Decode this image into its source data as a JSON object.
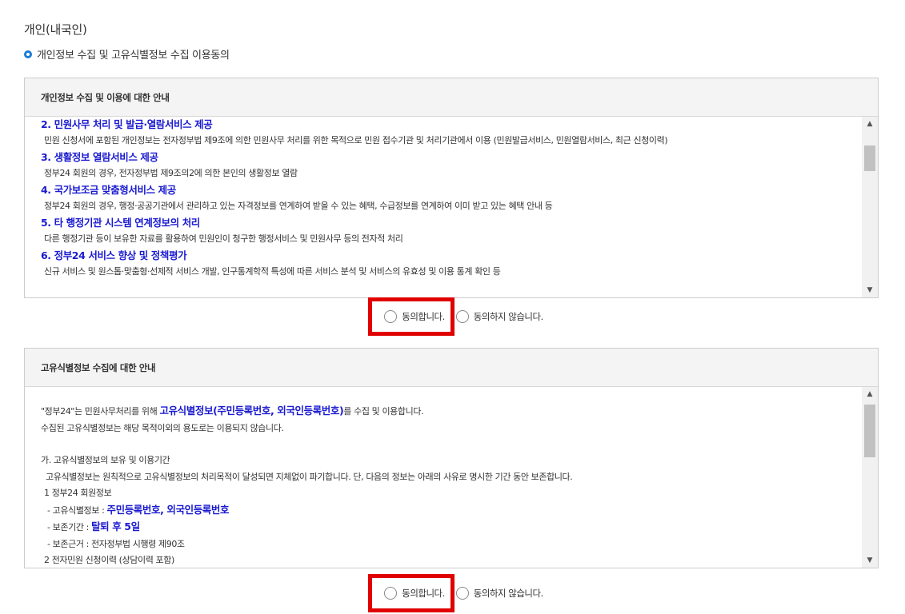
{
  "page": {
    "title": "개인(내국인)",
    "subtitle": "개인정보 수집 및 고유식별정보 수집 이용동의"
  },
  "panel1": {
    "header": "개인정보 수집 및 이용에 대한 안내",
    "sections": [
      {
        "title": "2. 민원사무 처리 및 발급·열람서비스 제공",
        "desc": "민원 신청서에 포함된 개인정보는 전자정부법 제9조에 의한 민원사무 처리를 위한 목적으로 민원 접수기관 및 처리기관에서 이용 (민원발급서비스, 민원열람서비스, 최근 신청이력)"
      },
      {
        "title": "3. 생활정보 열람서비스 제공",
        "desc": "정부24 회원의 경우, 전자정부법 제9조의2에 의한 본인의 생활정보 열람"
      },
      {
        "title": "4. 국가보조금 맞춤형서비스 제공",
        "desc": "정부24 회원의 경우, 행정·공공기관에서 관리하고 있는 자격정보를 연계하여 받을 수 있는 혜택, 수급정보를 연계하여 이미 받고 있는 혜택 안내 등"
      },
      {
        "title": "5. 타 행정기관 시스템 연계정보의 처리",
        "desc": "다른 행정기관 등이 보유한 자료를 활용하여 민원인이 청구한 행정서비스 및 민원사무 등의 전자적 처리"
      },
      {
        "title": "6. 정부24 서비스 향상 및 정책평가",
        "desc": "신규 서비스 및 원스톱·맞춤형·선제적 서비스 개발, 인구통계학적 특성에 따른 서비스 분석 및 서비스의 유효성 및 이용 통계 확인 등"
      }
    ],
    "agree_label": "동의합니다.",
    "disagree_label": "동의하지 않습니다."
  },
  "panel2": {
    "header": "고유식별정보 수집에 대한 안내",
    "intro_pre": "\"정부24\"는 민원사무처리를 위해",
    "intro_hl": "고유식별정보(주민등록번호, 외국인등록번호)",
    "intro_post": "를 수집 및 이용합니다.",
    "intro2": "수집된 고유식별정보는 해당 목적이외의 용도로는 이용되지 않습니다.",
    "sec_title": "가. 고유식별정보의 보유 및 이용기간",
    "sec_desc": "고유식별정보는 원칙적으로 고유식별정보의 처리목적이 달성되면 지체없이 파기합니다. 단, 다음의 정보는 아래의 사유로 명시한 기간 동안 보존합니다.",
    "item1": "1 정부24 회원정보",
    "item1_a_label": "- 고유식별정보 :",
    "item1_a_value": "주민등록번호, 외국인등록번호",
    "item1_b_label": "- 보존기간 :",
    "item1_b_value": "탈퇴 후 5일",
    "item1_c": "- 보존근거 : 전자정부법 시행령 제90조",
    "item2": "2 전자민원 신청이력 (상담이력 포함)",
    "agree_label": "동의합니다.",
    "disagree_label": "동의하지 않습니다."
  }
}
